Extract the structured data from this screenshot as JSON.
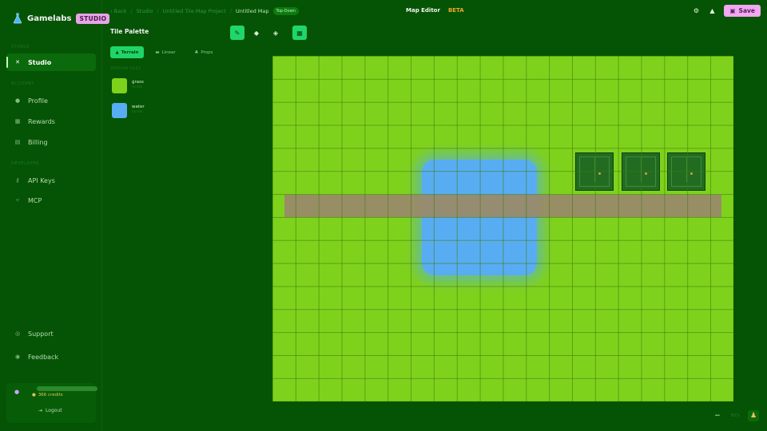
{
  "brand": {
    "name": "Gamelabs",
    "badge": "STUDIO"
  },
  "sidebar": {
    "section_studio": "STUDIO",
    "section_account": "ACCOUNT",
    "section_developer": "DEVELOPER",
    "items": [
      {
        "label": "Studio",
        "icon": "studio-icon"
      },
      {
        "label": "Profile",
        "icon": "person-icon"
      },
      {
        "label": "Rewards",
        "icon": "gift-icon"
      },
      {
        "label": "Billing",
        "icon": "card-icon"
      },
      {
        "label": "API Keys",
        "icon": "key-icon"
      },
      {
        "label": "MCP",
        "icon": "branch-icon"
      },
      {
        "label": "Support",
        "icon": "support-icon"
      },
      {
        "label": "Feedback",
        "icon": "chat-icon"
      }
    ],
    "user": {
      "credits": "366 credits",
      "logout": "Logout"
    }
  },
  "header": {
    "back": "Back",
    "crumb_studio": "Studio",
    "crumb_project": "Untitled Tile Map Project",
    "crumb_current": "Untitled Map",
    "view_mode": "Top-Down",
    "title": "Map Editor",
    "beta": "BETA",
    "save": "Save"
  },
  "palette": {
    "title": "Tile Palette",
    "tabs": [
      "Terrain",
      "Linear",
      "Props"
    ],
    "section": "TERRAIN TILES",
    "tiles": [
      {
        "name": "grass",
        "sub": "terrain",
        "color": "#7fd21c"
      },
      {
        "name": "water",
        "sub": "terrain",
        "color": "#58adf2"
      }
    ]
  },
  "colors": {
    "accent": "#20d66b",
    "grass": "#7fd21c",
    "water": "#58adf2",
    "path": "#9a8a6a",
    "save": "#f0a8f0",
    "beta": "#f2a62a"
  },
  "zoom": {
    "level": "80%"
  }
}
